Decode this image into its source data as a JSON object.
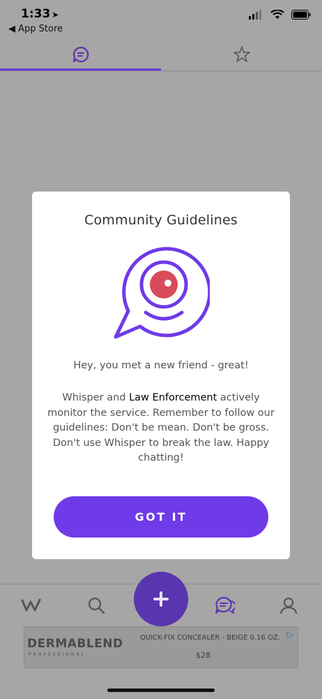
{
  "status_bar": {
    "time": "1:33",
    "back_label": "App Store"
  },
  "top_tabs": [
    {
      "icon": "chat-icon",
      "active": true
    },
    {
      "icon": "star-icon",
      "active": false
    }
  ],
  "modal": {
    "title": "Community Guidelines",
    "icon": "whisper-eye-bubble-icon",
    "message_1": "Hey, you met a new friend - great!",
    "message_2_prefix": "Whisper and ",
    "message_2_highlight": "Law Enforcement",
    "message_2_suffix": " actively monitor the service. Remember to follow our guidelines: Don't be mean. Don't be gross. Don't use Whisper to break the law. Happy chatting!",
    "button_label": "GOT IT"
  },
  "bottom_nav": {
    "items": [
      {
        "name": "home",
        "icon": "whisper-logo-icon"
      },
      {
        "name": "search",
        "icon": "search-icon"
      },
      {
        "name": "create",
        "icon": "plus-icon"
      },
      {
        "name": "messages",
        "icon": "chat-icon",
        "active": true
      },
      {
        "name": "profile",
        "icon": "user-icon"
      }
    ]
  },
  "ad": {
    "brand": "DERMABLEND",
    "brand_sub": "PROFESSIONAL",
    "product": "QUICK-FIX CONCEALER - BEIGE 0.16 OZ.",
    "price": "$28"
  },
  "colors": {
    "accent": "#6f3ae8",
    "overlay": "#a6a6a6",
    "eye": "#d94a5a"
  }
}
